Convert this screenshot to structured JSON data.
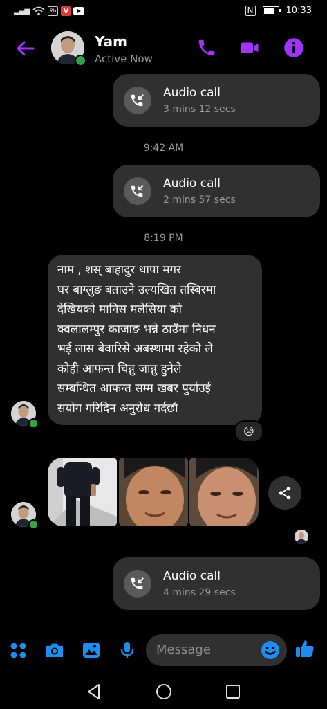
{
  "status_bar": {
    "carrier_badge": "२७",
    "v_badge": "V",
    "nfc": "N",
    "time": "10:33"
  },
  "header": {
    "name": "Yam",
    "status": "Active Now"
  },
  "messages": {
    "call1": {
      "title": "Audio call",
      "duration": "3 mins 12 secs"
    },
    "time1": "9:42 AM",
    "call2": {
      "title": "Audio call",
      "duration": "2 mins 57 secs"
    },
    "time2": "8:19 PM",
    "text_lines": [
      "नाम  , शस् बाहादुर थापा मगर",
      "घर बाग्लुङ बताउने उल्यखित तस्बिरमा",
      "देखियको मानिस मलेसिया को",
      "क्वलालम्पुर काजाङ भन्ने ठाउँमा निधन",
      "भई लास बेवारिसे अबस्थामा रहेको ले",
      "कोही आफन्त चिन्नु जान्नु हुनेले",
      "सम्बन्धित आफन्त सम्म खबर पुर्याउई",
      "सयोग गरिदिन अनुरोध गर्दछौ"
    ],
    "reaction": "😥",
    "call3": {
      "title": "Audio call",
      "duration": "4 mins 29 secs"
    }
  },
  "composer": {
    "placeholder": "Message"
  },
  "colors": {
    "accent": "#a033ff",
    "composer_icon": "#1f8ef1",
    "bubble": "#303030",
    "online": "#31a24c"
  }
}
